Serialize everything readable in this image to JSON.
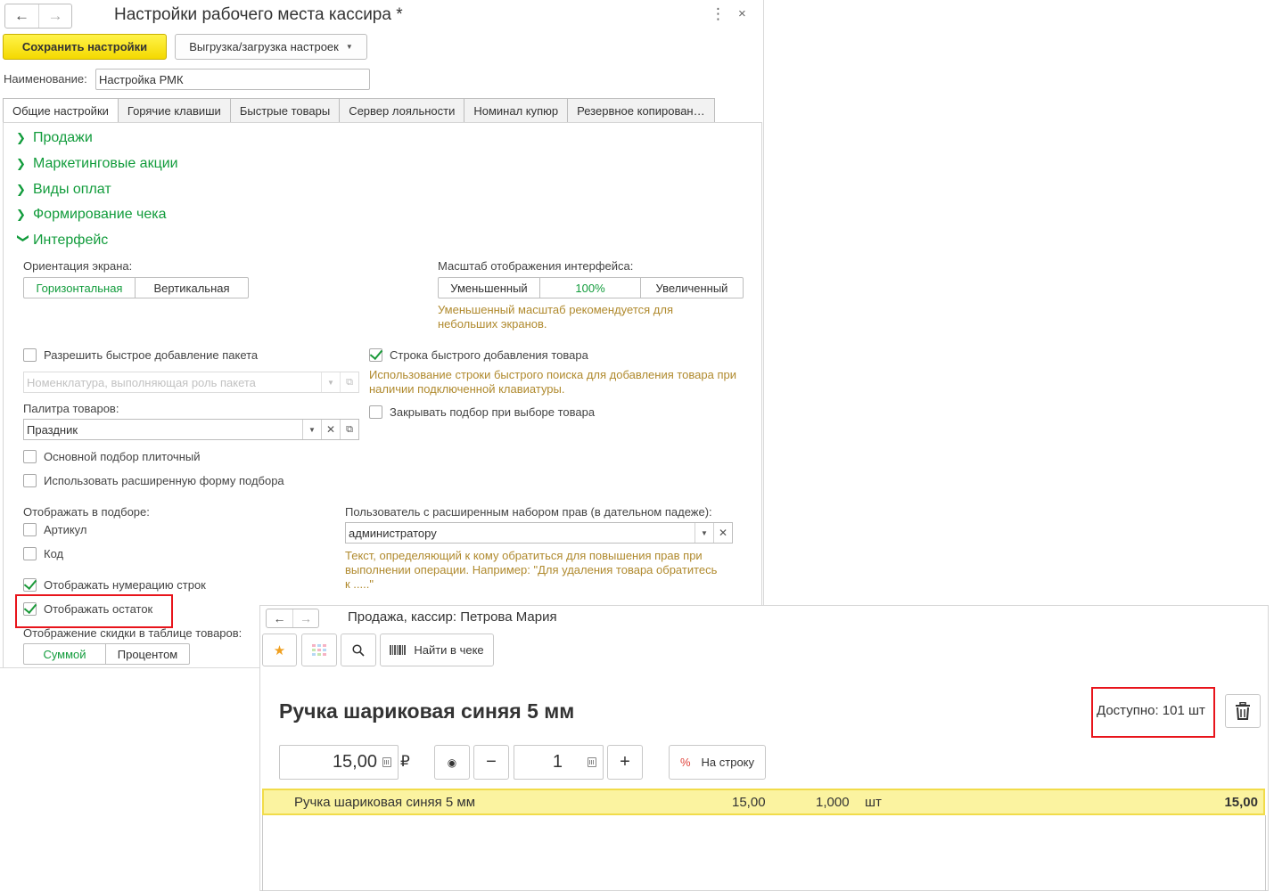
{
  "settings_window": {
    "title": "Настройки рабочего места кассира *",
    "nav": {
      "back_icon": "←",
      "forward_icon": "→"
    },
    "more_icon": "⋮",
    "close_icon": "×",
    "save_label": "Сохранить настройки",
    "export_label": "Выгрузка/загрузка настроек",
    "name_label": "Наименование:",
    "name_value": "Настройка РМК",
    "tabs": [
      "Общие настройки",
      "Горячие клавиши",
      "Быстрые товары",
      "Сервер лояльности",
      "Номинал купюр",
      "Резервное копирован…"
    ],
    "sections": [
      {
        "label": "Продажи",
        "expanded": false
      },
      {
        "label": "Маркетинговые акции",
        "expanded": false
      },
      {
        "label": "Виды оплат",
        "expanded": false
      },
      {
        "label": "Формирование чека",
        "expanded": false
      },
      {
        "label": "Интерфейс",
        "expanded": true
      }
    ],
    "interface": {
      "orientation_label": "Ориентация экрана:",
      "orientation_options": [
        "Горизонтальная",
        "Вертикальная"
      ],
      "orientation_selected": "Горизонтальная",
      "scale_label": "Масштаб отображения интерфейса:",
      "scale_options": [
        "Уменьшенный",
        "100%",
        "Увеличенный"
      ],
      "scale_selected": "100%",
      "scale_hint": "Уменьшенный масштаб рекомендуется для небольших экранов.",
      "quick_package_label": "Разрешить быстрое добавление пакета",
      "quick_package_checked": false,
      "package_item_placeholder": "Номенклатура, выполняющая роль пакета",
      "quick_add_row_label": "Строка быстрого добавления товара",
      "quick_add_row_checked": true,
      "quick_add_row_hint": "Использование строки быстрого поиска для добавления товара при наличии подключенной клавиатуры.",
      "close_selection_label": "Закрывать подбор при выборе товара",
      "close_selection_checked": false,
      "palette_label": "Палитра товаров:",
      "palette_value": "Праздник",
      "tile_selection_label": "Основной подбор плиточный",
      "tile_selection_checked": false,
      "extended_form_label": "Использовать расширенную форму подбора",
      "extended_form_checked": false,
      "show_in_selection_label": "Отображать в подборе:",
      "article_label": "Артикул",
      "article_checked": false,
      "code_label": "Код",
      "code_checked": false,
      "user_rights_label": "Пользователь с расширенным набором прав (в дательном падеже):",
      "user_rights_value": "администратору",
      "user_rights_hint": "Текст, определяющий к кому обратиться для повышения прав при выполнении операции. Например: \"Для удаления товара обратитесь к .....\"",
      "row_numbering_label": "Отображать нумерацию строк",
      "row_numbering_checked": true,
      "show_stock_label": "Отображать остаток",
      "show_stock_checked": true,
      "discount_display_label": "Отображение скидки в таблице товаров:",
      "discount_options": [
        "Суммой",
        "Процентом"
      ],
      "discount_selected": "Суммой"
    }
  },
  "sale_window": {
    "title": "Продажа, кассир: Петрова Мария",
    "find_in_receipt_label": "Найти в чеке",
    "product_name": "Ручка шариковая синяя 5 мм",
    "available_text": "Доступно: 101 шт",
    "price_value": "15,00",
    "currency": "₽",
    "quantity_value": "1",
    "minus": "−",
    "plus": "+",
    "discount_button_label": "На строку",
    "discount_icon": "%",
    "receipt_rows": [
      {
        "name": "Ручка шариковая синяя 5 мм",
        "price": "15,00",
        "qty": "1,000",
        "unit": "шт",
        "total": "15,00"
      }
    ]
  },
  "colors": {
    "accent_green": "#129c3c",
    "save_yellow": "#f4d900",
    "highlight_red": "#e8141b",
    "row_yellow": "#fbf3a0",
    "hint_brown": "#b08a2e"
  }
}
